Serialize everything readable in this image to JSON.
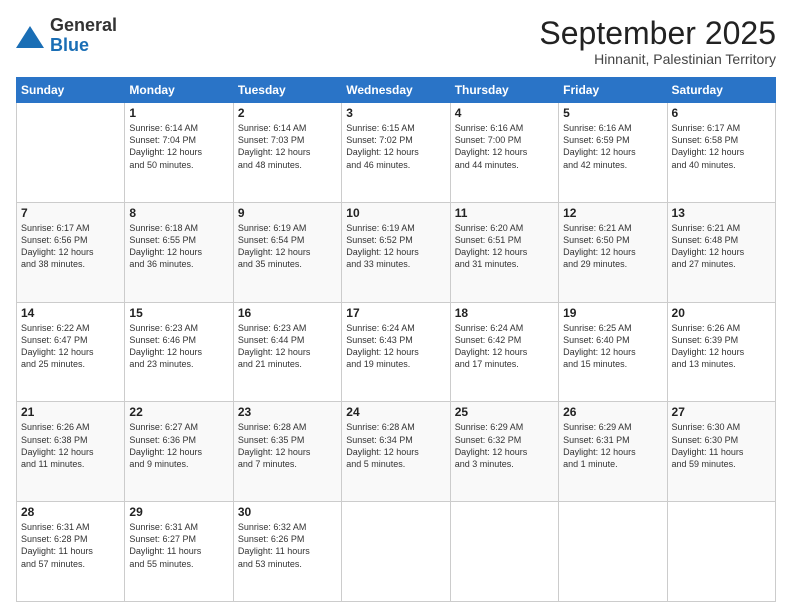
{
  "header": {
    "logo_general": "General",
    "logo_blue": "Blue",
    "month_title": "September 2025",
    "location": "Hinnanit, Palestinian Territory"
  },
  "days_of_week": [
    "Sunday",
    "Monday",
    "Tuesday",
    "Wednesday",
    "Thursday",
    "Friday",
    "Saturday"
  ],
  "weeks": [
    [
      {
        "day": null,
        "info": null
      },
      {
        "day": "1",
        "info": "Sunrise: 6:14 AM\nSunset: 7:04 PM\nDaylight: 12 hours\nand 50 minutes."
      },
      {
        "day": "2",
        "info": "Sunrise: 6:14 AM\nSunset: 7:03 PM\nDaylight: 12 hours\nand 48 minutes."
      },
      {
        "day": "3",
        "info": "Sunrise: 6:15 AM\nSunset: 7:02 PM\nDaylight: 12 hours\nand 46 minutes."
      },
      {
        "day": "4",
        "info": "Sunrise: 6:16 AM\nSunset: 7:00 PM\nDaylight: 12 hours\nand 44 minutes."
      },
      {
        "day": "5",
        "info": "Sunrise: 6:16 AM\nSunset: 6:59 PM\nDaylight: 12 hours\nand 42 minutes."
      },
      {
        "day": "6",
        "info": "Sunrise: 6:17 AM\nSunset: 6:58 PM\nDaylight: 12 hours\nand 40 minutes."
      }
    ],
    [
      {
        "day": "7",
        "info": "Sunrise: 6:17 AM\nSunset: 6:56 PM\nDaylight: 12 hours\nand 38 minutes."
      },
      {
        "day": "8",
        "info": "Sunrise: 6:18 AM\nSunset: 6:55 PM\nDaylight: 12 hours\nand 36 minutes."
      },
      {
        "day": "9",
        "info": "Sunrise: 6:19 AM\nSunset: 6:54 PM\nDaylight: 12 hours\nand 35 minutes."
      },
      {
        "day": "10",
        "info": "Sunrise: 6:19 AM\nSunset: 6:52 PM\nDaylight: 12 hours\nand 33 minutes."
      },
      {
        "day": "11",
        "info": "Sunrise: 6:20 AM\nSunset: 6:51 PM\nDaylight: 12 hours\nand 31 minutes."
      },
      {
        "day": "12",
        "info": "Sunrise: 6:21 AM\nSunset: 6:50 PM\nDaylight: 12 hours\nand 29 minutes."
      },
      {
        "day": "13",
        "info": "Sunrise: 6:21 AM\nSunset: 6:48 PM\nDaylight: 12 hours\nand 27 minutes."
      }
    ],
    [
      {
        "day": "14",
        "info": "Sunrise: 6:22 AM\nSunset: 6:47 PM\nDaylight: 12 hours\nand 25 minutes."
      },
      {
        "day": "15",
        "info": "Sunrise: 6:23 AM\nSunset: 6:46 PM\nDaylight: 12 hours\nand 23 minutes."
      },
      {
        "day": "16",
        "info": "Sunrise: 6:23 AM\nSunset: 6:44 PM\nDaylight: 12 hours\nand 21 minutes."
      },
      {
        "day": "17",
        "info": "Sunrise: 6:24 AM\nSunset: 6:43 PM\nDaylight: 12 hours\nand 19 minutes."
      },
      {
        "day": "18",
        "info": "Sunrise: 6:24 AM\nSunset: 6:42 PM\nDaylight: 12 hours\nand 17 minutes."
      },
      {
        "day": "19",
        "info": "Sunrise: 6:25 AM\nSunset: 6:40 PM\nDaylight: 12 hours\nand 15 minutes."
      },
      {
        "day": "20",
        "info": "Sunrise: 6:26 AM\nSunset: 6:39 PM\nDaylight: 12 hours\nand 13 minutes."
      }
    ],
    [
      {
        "day": "21",
        "info": "Sunrise: 6:26 AM\nSunset: 6:38 PM\nDaylight: 12 hours\nand 11 minutes."
      },
      {
        "day": "22",
        "info": "Sunrise: 6:27 AM\nSunset: 6:36 PM\nDaylight: 12 hours\nand 9 minutes."
      },
      {
        "day": "23",
        "info": "Sunrise: 6:28 AM\nSunset: 6:35 PM\nDaylight: 12 hours\nand 7 minutes."
      },
      {
        "day": "24",
        "info": "Sunrise: 6:28 AM\nSunset: 6:34 PM\nDaylight: 12 hours\nand 5 minutes."
      },
      {
        "day": "25",
        "info": "Sunrise: 6:29 AM\nSunset: 6:32 PM\nDaylight: 12 hours\nand 3 minutes."
      },
      {
        "day": "26",
        "info": "Sunrise: 6:29 AM\nSunset: 6:31 PM\nDaylight: 12 hours\nand 1 minute."
      },
      {
        "day": "27",
        "info": "Sunrise: 6:30 AM\nSunset: 6:30 PM\nDaylight: 11 hours\nand 59 minutes."
      }
    ],
    [
      {
        "day": "28",
        "info": "Sunrise: 6:31 AM\nSunset: 6:28 PM\nDaylight: 11 hours\nand 57 minutes."
      },
      {
        "day": "29",
        "info": "Sunrise: 6:31 AM\nSunset: 6:27 PM\nDaylight: 11 hours\nand 55 minutes."
      },
      {
        "day": "30",
        "info": "Sunrise: 6:32 AM\nSunset: 6:26 PM\nDaylight: 11 hours\nand 53 minutes."
      },
      {
        "day": null,
        "info": null
      },
      {
        "day": null,
        "info": null
      },
      {
        "day": null,
        "info": null
      },
      {
        "day": null,
        "info": null
      }
    ]
  ]
}
